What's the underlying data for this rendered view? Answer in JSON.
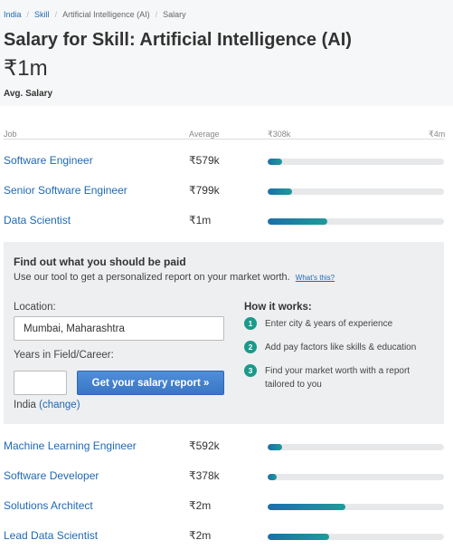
{
  "breadcrumb": {
    "items": [
      "India",
      "Skill",
      "Artificial Intelligence (AI)",
      "Salary"
    ],
    "separator": "/"
  },
  "title": "Salary for Skill: Artificial Intelligence (AI)",
  "average": {
    "value": "₹1m",
    "label": "Avg. Salary"
  },
  "table": {
    "headers": {
      "job": "Job",
      "average": "Average",
      "min": "₹308k",
      "max": "₹4m"
    },
    "rows_top": [
      {
        "job": "Software Engineer",
        "average": "₹579k",
        "fill_fraction": 0.08
      },
      {
        "job": "Senior Software Engineer",
        "average": "₹799k",
        "fill_fraction": 0.14
      },
      {
        "job": "Data Scientist",
        "average": "₹1m",
        "fill_fraction": 0.34
      }
    ],
    "rows_bottom": [
      {
        "job": "Machine Learning Engineer",
        "average": "₹592k",
        "fill_fraction": 0.08
      },
      {
        "job": "Software Developer",
        "average": "₹378k",
        "fill_fraction": 0.05
      },
      {
        "job": "Solutions Architect",
        "average": "₹2m",
        "fill_fraction": 0.44
      },
      {
        "job": "Lead Data Scientist",
        "average": "₹2m",
        "fill_fraction": 0.35
      }
    ]
  },
  "panel": {
    "title": "Find out what you should be paid",
    "subtitle": "Use our tool to get a personalized report on your market worth.",
    "whats_this": "What's this?",
    "location_label": "Location:",
    "location_value": "Mumbai, Maharashtra",
    "years_label": "Years in Field/Career:",
    "years_value": "",
    "cta_label": "Get your salary report »",
    "country": "India",
    "change_label": "(change)",
    "how_title": "How it works:",
    "steps": [
      {
        "num": "1",
        "text": "Enter city & years of experience"
      },
      {
        "num": "2",
        "text": "Add pay factors like skills & education"
      },
      {
        "num": "3",
        "text": "Find your market worth with a report tailored to you"
      }
    ]
  },
  "colors": {
    "link": "#1f69b3",
    "bar_start": "#1b6fa8",
    "bar_end": "#1f9a9a",
    "step_badge": "#1a9a8a",
    "cta": "#3a76c4"
  }
}
